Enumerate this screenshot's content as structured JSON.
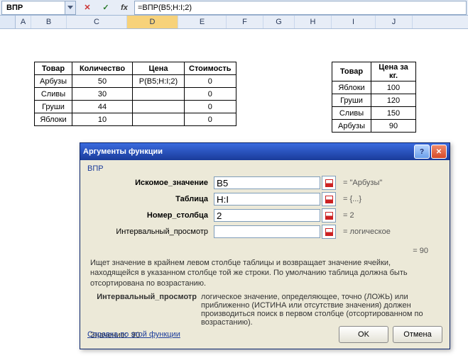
{
  "formula_bar": {
    "namebox": "ВПР",
    "formula": "=ВПР(B5;H:I;2)",
    "cancel": "✕",
    "accept": "✓",
    "fx": "fx"
  },
  "columns": [
    "A",
    "B",
    "C",
    "D",
    "E",
    "F",
    "G",
    "H",
    "I",
    "J"
  ],
  "table1": {
    "headers": [
      "Товар",
      "Количество",
      "Цена",
      "Стоимость"
    ],
    "rows": [
      [
        "Арбузы",
        "50",
        "Р(B5;H:I;2)",
        "0"
      ],
      [
        "Сливы",
        "30",
        "",
        "0"
      ],
      [
        "Груши",
        "44",
        "",
        "0"
      ],
      [
        "Яблоки",
        "10",
        "",
        "0"
      ]
    ]
  },
  "table2": {
    "headers": [
      "Товар",
      "Цена за кг."
    ],
    "rows": [
      [
        "Яблоки",
        "100"
      ],
      [
        "Груши",
        "120"
      ],
      [
        "Сливы",
        "150"
      ],
      [
        "Арбузы",
        "90"
      ]
    ]
  },
  "dialog": {
    "title": "Аргументы функции",
    "func": "ВПР",
    "args": [
      {
        "label": "Искомое_значение",
        "value": "B5",
        "result": "= \"Арбузы\"",
        "bold": true
      },
      {
        "label": "Таблица",
        "value": "H:I",
        "result": "= {...}",
        "bold": true
      },
      {
        "label": "Номер_столбца",
        "value": "2",
        "result": "= 2",
        "bold": true
      },
      {
        "label": "Интервальный_просмотр",
        "value": "",
        "result": "= логическое",
        "bold": false
      }
    ],
    "result_line": "= 90",
    "description": "Ищет значение в крайнем левом столбце таблицы и возвращает значение ячейки, находящейся в указанном столбце той же строки. По умолчанию таблица должна быть отсортирована по возрастанию.",
    "arg_help": {
      "name": "Интервальный_просмотр",
      "text": "логическое значение, определяющее, точно (ЛОЖЬ) или приближенно (ИСТИНА или отсутствие значения) должен производиться поиск в первом столбце (отсортированном по возрастанию)."
    },
    "value_label": "Значение:",
    "value": "90",
    "help_link": "Справка по этой функции",
    "ok": "OK",
    "cancel": "Отмена"
  },
  "chart_data": {
    "type": "table",
    "title": "Spreadsheet data",
    "tables": [
      {
        "headers": [
          "Товар",
          "Количество",
          "Цена",
          "Стоимость"
        ],
        "rows": [
          [
            "Арбузы",
            50,
            null,
            0
          ],
          [
            "Сливы",
            30,
            null,
            0
          ],
          [
            "Груши",
            44,
            null,
            0
          ],
          [
            "Яблоки",
            10,
            null,
            0
          ]
        ]
      },
      {
        "headers": [
          "Товар",
          "Цена за кг."
        ],
        "rows": [
          [
            "Яблоки",
            100
          ],
          [
            "Груши",
            120
          ],
          [
            "Сливы",
            150
          ],
          [
            "Арбузы",
            90
          ]
        ]
      }
    ]
  }
}
